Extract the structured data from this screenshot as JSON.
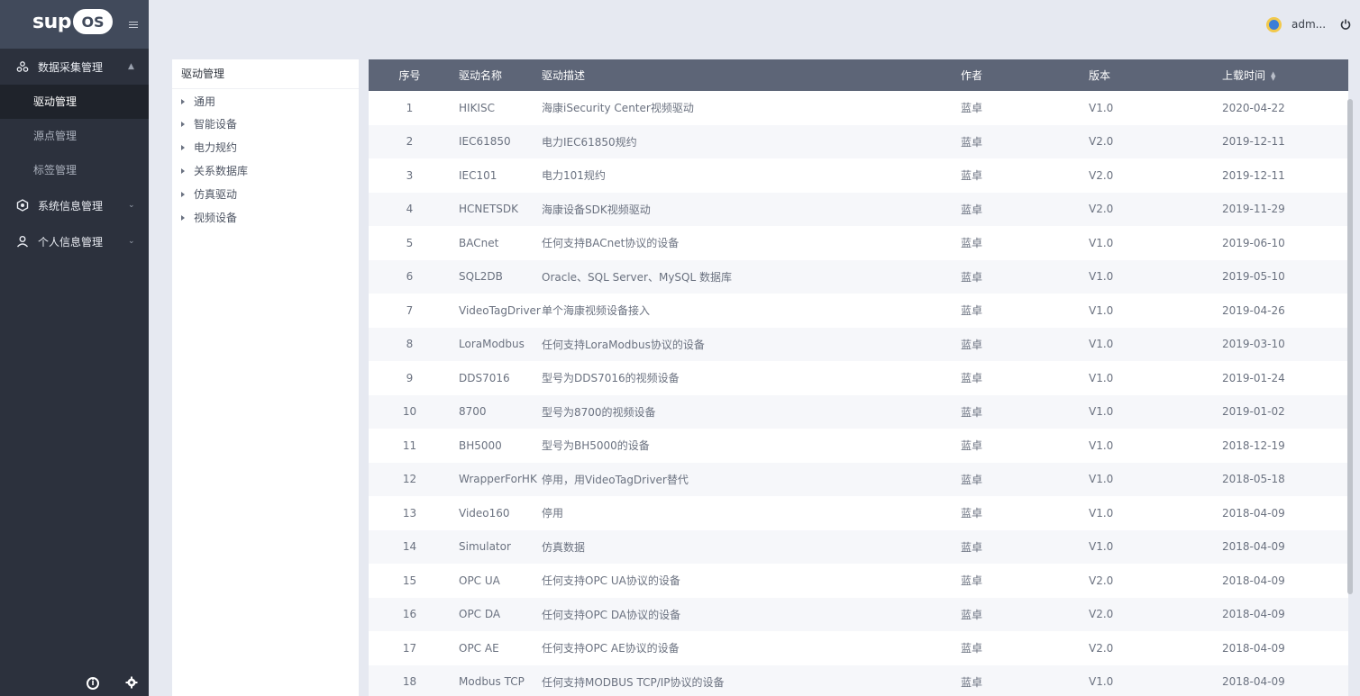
{
  "app": {
    "logo_text": "sup",
    "logo_os": "OS"
  },
  "sidebar": {
    "groups": [
      {
        "label": "数据采集管理",
        "icon": "nodes-icon",
        "expanded": true,
        "items": [
          {
            "label": "驱动管理",
            "active": true
          },
          {
            "label": "源点管理",
            "active": false
          },
          {
            "label": "标签管理",
            "active": false
          }
        ]
      },
      {
        "label": "系统信息管理",
        "icon": "hexagon-icon",
        "expanded": false
      },
      {
        "label": "个人信息管理",
        "icon": "user-icon",
        "expanded": false
      }
    ]
  },
  "header": {
    "username": "adm..."
  },
  "tree": {
    "title": "驱动管理",
    "items": [
      "通用",
      "智能设备",
      "电力规约",
      "关系数据库",
      "仿真驱动",
      "视频设备"
    ]
  },
  "table": {
    "columns": [
      "序号",
      "驱动名称",
      "驱动描述",
      "作者",
      "版本",
      "上载时间"
    ],
    "rows": [
      [
        "1",
        "HIKISC",
        "海康iSecurity Center视频驱动",
        "蓝卓",
        "V1.0",
        "2020-04-22"
      ],
      [
        "2",
        "IEC61850",
        "电力IEC61850规约",
        "蓝卓",
        "V2.0",
        "2019-12-11"
      ],
      [
        "3",
        "IEC101",
        "电力101规约",
        "蓝卓",
        "V2.0",
        "2019-12-11"
      ],
      [
        "4",
        "HCNETSDK",
        "海康设备SDK视频驱动",
        "蓝卓",
        "V2.0",
        "2019-11-29"
      ],
      [
        "5",
        "BACnet",
        "任何支持BACnet协议的设备",
        "蓝卓",
        "V1.0",
        "2019-06-10"
      ],
      [
        "6",
        "SQL2DB",
        "Oracle、SQL Server、MySQL 数据库",
        "蓝卓",
        "V1.0",
        "2019-05-10"
      ],
      [
        "7",
        "VideoTagDriver",
        "单个海康视频设备接入",
        "蓝卓",
        "V1.0",
        "2019-04-26"
      ],
      [
        "8",
        "LoraModbus",
        "任何支持LoraModbus协议的设备",
        "蓝卓",
        "V1.0",
        "2019-03-10"
      ],
      [
        "9",
        "DDS7016",
        "型号为DDS7016的视频设备",
        "蓝卓",
        "V1.0",
        "2019-01-24"
      ],
      [
        "10",
        "8700",
        "型号为8700的视频设备",
        "蓝卓",
        "V1.0",
        "2019-01-02"
      ],
      [
        "11",
        "BH5000",
        "型号为BH5000的设备",
        "蓝卓",
        "V1.0",
        "2018-12-19"
      ],
      [
        "12",
        "WrapperForHK",
        "停用，用VideoTagDriver替代",
        "蓝卓",
        "V1.0",
        "2018-05-18"
      ],
      [
        "13",
        "Video160",
        "停用",
        "蓝卓",
        "V1.0",
        "2018-04-09"
      ],
      [
        "14",
        "Simulator",
        "仿真数据",
        "蓝卓",
        "V1.0",
        "2018-04-09"
      ],
      [
        "15",
        "OPC UA",
        "任何支持OPC UA协议的设备",
        "蓝卓",
        "V2.0",
        "2018-04-09"
      ],
      [
        "16",
        "OPC DA",
        "任何支持OPC DA协议的设备",
        "蓝卓",
        "V2.0",
        "2018-04-09"
      ],
      [
        "17",
        "OPC AE",
        "任何支持OPC AE协议的设备",
        "蓝卓",
        "V2.0",
        "2018-04-09"
      ],
      [
        "18",
        "Modbus TCP",
        "任何支持MODBUS TCP/IP协议的设备",
        "蓝卓",
        "V1.0",
        "2018-04-09"
      ]
    ]
  },
  "colors": {
    "sidebar_bg": "#2c313d",
    "header_row": "#5d6577",
    "active_item": "#1f232b"
  }
}
